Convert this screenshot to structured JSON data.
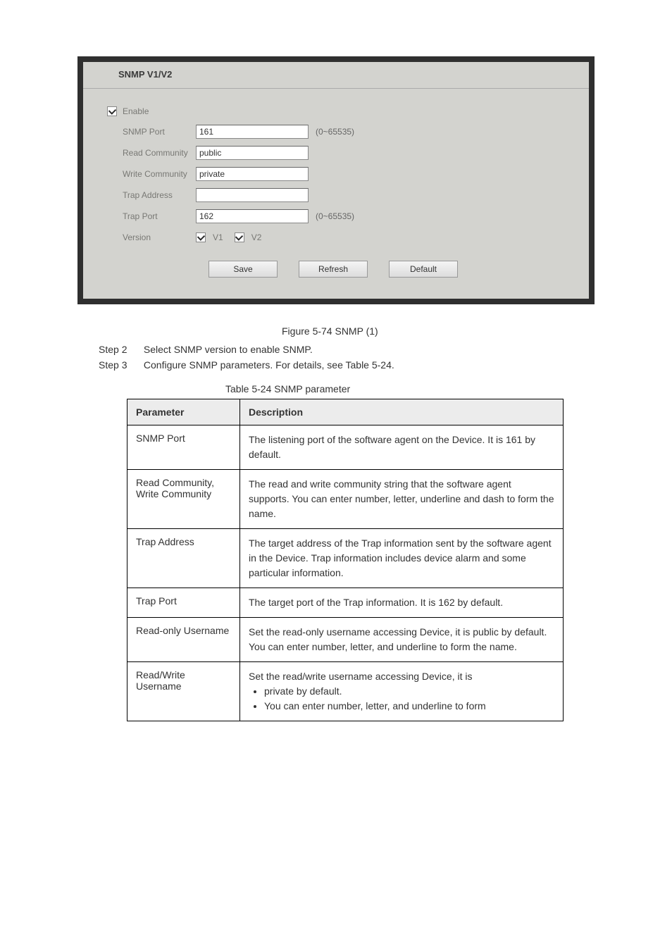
{
  "screenshot": {
    "tab": "SNMP V1/V2",
    "enable_label": "Enable",
    "rows": {
      "snmp_port": {
        "label": "SNMP Port",
        "value": "161",
        "hint": "(0~65535)"
      },
      "read_community": {
        "label": "Read Community",
        "value": "public"
      },
      "write_community": {
        "label": "Write Community",
        "value": "private"
      },
      "trap_address": {
        "label": "Trap Address",
        "value": ""
      },
      "trap_port": {
        "label": "Trap Port",
        "value": "162",
        "hint": "(0~65535)"
      },
      "version": {
        "label": "Version",
        "v1": "V1",
        "v2": "V2"
      }
    },
    "buttons": {
      "save": "Save",
      "refresh": "Refresh",
      "default": "Default"
    }
  },
  "figure_caption": "Figure 5-74 SNMP (1)",
  "step2": {
    "tag": "Step 2",
    "text": "Select SNMP version to enable SNMP."
  },
  "step3": {
    "tag": "Step 3",
    "text": "Configure SNMP parameters. For details, see Table 5-24."
  },
  "table_caption": "Table 5-24 SNMP parameter",
  "table": {
    "header_param": "Parameter",
    "header_desc": "Description",
    "rows": [
      {
        "param": "SNMP Port",
        "desc": "The listening port of the software agent on the Device. It is 161 by default."
      },
      {
        "param": "Read Community, Write Community",
        "desc": "The read and write community string that the software agent supports. You can enter number, letter, underline and dash to form the name."
      },
      {
        "param": "Trap Address",
        "desc": "The target address of the Trap information sent by the software agent in the Device. Trap information includes device alarm and some particular information."
      },
      {
        "param": "Trap Port",
        "desc": "The target port of the Trap information. It is 162 by default."
      },
      {
        "param": "Read-only Username",
        "desc": "Set the read-only username accessing Device, it is public by default. You can enter number, letter, and underline to form the name."
      },
      {
        "param": "Read/Write Username",
        "desc_intro": "Set the read/write username accessing Device, it is",
        "desc_bullets": [
          "private by default.",
          "You can enter number, letter, and underline to form"
        ]
      }
    ]
  }
}
